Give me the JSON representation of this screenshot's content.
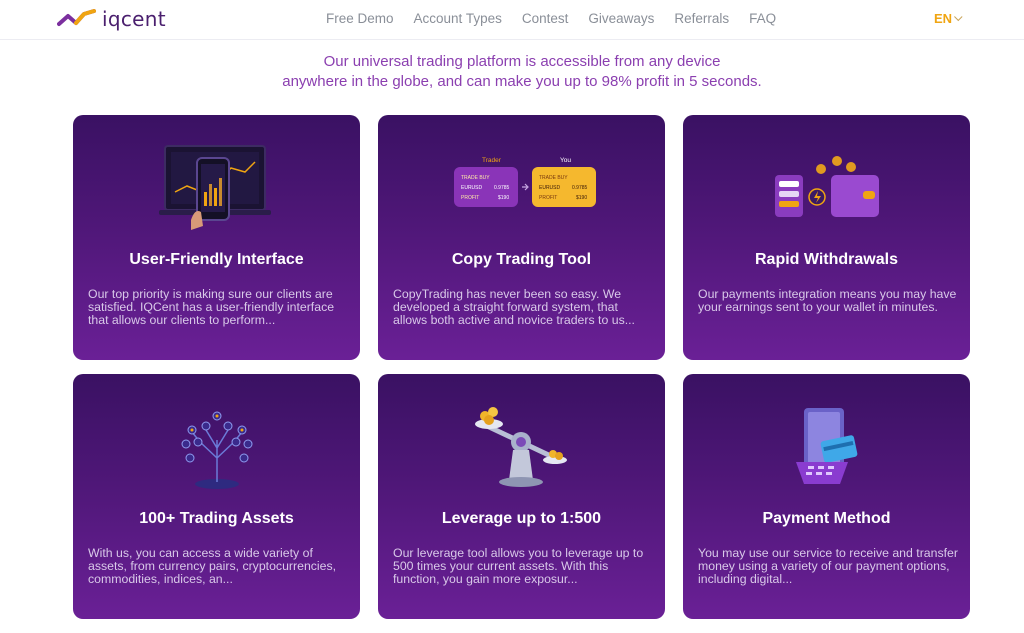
{
  "header": {
    "logo_text": "iqcent",
    "nav": [
      "Free Demo",
      "Account Types",
      "Contest",
      "Giveaways",
      "Referrals",
      "FAQ"
    ],
    "language": "EN"
  },
  "intro": {
    "line1": "Our universal trading platform is accessible from any device",
    "line2": "anywhere in the globe, and can make you up to 98% profit in 5 seconds."
  },
  "cards": [
    {
      "title": "User-Friendly Interface",
      "desc": "Our top priority is making sure our clients are satisfied. IQCent has a user-friendly interface that allows our clients to perform...",
      "icon": "laptop-phone-chart-icon"
    },
    {
      "title": "Copy Trading Tool",
      "desc": "CopyTrading has never been so easy. We developed a straight forward system, that allows both active and novice traders to us...",
      "icon": "copy-trade-icon",
      "illustration": {
        "trader_label": "Trader",
        "you_label": "You",
        "row1_label": "TRADE BUY",
        "row2_label": "EURUSD",
        "row2_value": "0.9785",
        "row3_label": "PROFIT",
        "row3_value": "$190"
      }
    },
    {
      "title": "Rapid Withdrawals",
      "desc": "Our payments integration means you may have your earnings sent to your wallet in minutes.",
      "icon": "wallet-transfer-icon"
    },
    {
      "title": "100+ Trading Assets",
      "desc": "With us, you can access a wide variety of assets, from currency pairs, cryptocurrencies, commodities, indices, an...",
      "icon": "asset-tree-icon"
    },
    {
      "title": "Leverage up to 1:500",
      "desc": "Our leverage tool allows you to leverage up to 500 times your current assets. With this function, you gain more exposur...",
      "icon": "leverage-scale-icon"
    },
    {
      "title": "Payment Method",
      "desc": "You may use our service to receive and transfer money using a variety of our payment options, including digital...",
      "icon": "card-terminal-icon"
    }
  ],
  "colors": {
    "accent": "#f0a512",
    "brand": "#4a1f6e",
    "intro_text": "#8b3fb0",
    "card_top": "#3a1163",
    "card_bottom": "#6a2096"
  }
}
